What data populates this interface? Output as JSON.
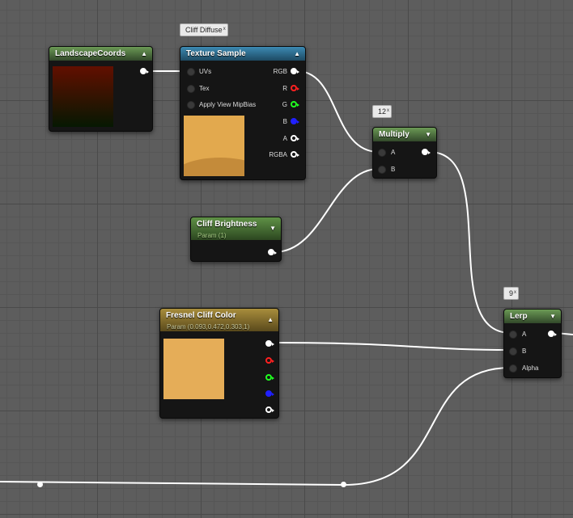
{
  "colors": {
    "accent_green": "#5f9146",
    "accent_blue": "#3c8ab3",
    "accent_gold": "#a88d3c",
    "pin_r": "#ff2020",
    "pin_g": "#20ff20",
    "pin_b": "#2020ff"
  },
  "nodes": {
    "landscape_coords": {
      "title": "LandscapeCoords",
      "collapse": "▲"
    },
    "texture_sample": {
      "comment": "Cliff Diffuse",
      "title": "Texture Sample",
      "collapse": "▲",
      "inputs": [
        "UVs",
        "Tex",
        "Apply View MipBias"
      ],
      "outputs": [
        "RGB",
        "R",
        "G",
        "B",
        "A",
        "RGBA"
      ]
    },
    "multiply": {
      "comment": "12",
      "title": "Multiply",
      "collapse": "▼",
      "inputs": [
        "A",
        "B"
      ]
    },
    "cliff_brightness": {
      "title": "Cliff Brightness",
      "subtitle": "Param (1)",
      "collapse": "▼"
    },
    "fresnel_cliff_color": {
      "title": "Fresnel Cliff Color",
      "subtitle": "Param (0.093,0.472,0.303,1)",
      "collapse": "▲"
    },
    "lerp": {
      "comment": "9",
      "title": "Lerp",
      "collapse": "▼",
      "inputs": [
        "A",
        "B",
        "Alpha"
      ]
    }
  }
}
